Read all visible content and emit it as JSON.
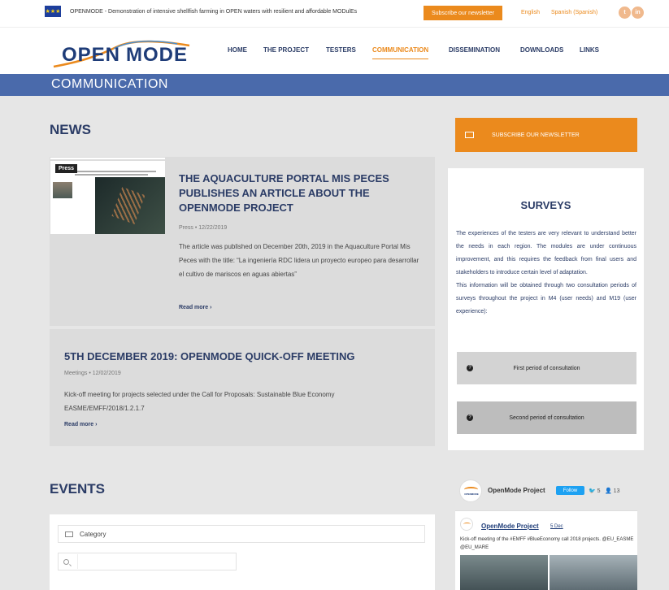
{
  "topbar": {
    "tagline": "OPENMODE - Demonstration of intensive shellfish farming in OPEN waters with resilient and affordable MODulEs",
    "subscribe_label": "Subscribe our newsletter",
    "lang_en": "English",
    "lang_es": "Spanish (Spanish)",
    "social": [
      "twitter-icon",
      "linkedin-icon"
    ]
  },
  "logo": {
    "left": "OPEN",
    "right": "MODE"
  },
  "nav": [
    {
      "label": "HOME"
    },
    {
      "label": "THE PROJECT"
    },
    {
      "label": "TESTERS"
    },
    {
      "label": "COMMUNICATION",
      "active": true
    },
    {
      "label": "DISSEMINATION"
    },
    {
      "label": "DOWNLOADS"
    },
    {
      "label": "LINKS"
    }
  ],
  "page_title": "COMMUNICATION",
  "news": {
    "heading": "NEWS",
    "items": [
      {
        "badge": "Press",
        "title": "THE AQUACULTURE PORTAL MIS PECES PUBLISHES AN ARTICLE ABOUT THE OPENMODE PROJECT",
        "meta": "Press • 12/22/2019",
        "excerpt": "The article was published on December 20th, 2019 in the Aquaculture Portal Mis Peces with the title: “La ingeniería RDC lidera un proyecto europeo para desarrollar el cultivo de mariscos en aguas abiertas”",
        "read_more": "Read more ›"
      },
      {
        "title": "5TH DECEMBER 2019: OPENMODE QUICK-OFF MEETING",
        "meta": "Meetings • 12/02/2019",
        "excerpt": "Kick-off meeting for projects selected under the Call for Proposals: Sustainable Blue Economy EASME/EMFF/2018/1.2.1.7",
        "read_more": "Read more ›"
      }
    ]
  },
  "sidebar": {
    "newsletter_label": "SUBSCRIBE OUR NEWSLETTER",
    "surveys": {
      "title": "SURVEYS",
      "text": "The experiences of the testers are very relevant to understand better the needs in each region. The modules are under continuous improvement, and this requires the feedback from final users and stakeholders to introduce certain level of adaptation.\nThis information will be obtained through two consultation periods of surveys throughout the project in M4 (user needs) and M19 (user experience):",
      "first": "First period of consultation",
      "second": "Second period of consultation"
    }
  },
  "events": {
    "heading": "EVENTS",
    "category_label": "Category",
    "search_placeholder": ""
  },
  "twitter": {
    "account": "OpenMode Project",
    "avatar_text": "OPENMODE",
    "follow": "Follow",
    "tweets": "5",
    "followers": "13",
    "author": "OpenMode Project",
    "date": "5 Dec",
    "text": "Kick-off meeting of the #EMFF #BlueEconomy call 2018 projects. @EU_EASME @EU_MARE"
  },
  "colors": {
    "accent": "#eb8a1d",
    "brand_blue": "#2b3c66",
    "band": "#4a6aab"
  }
}
